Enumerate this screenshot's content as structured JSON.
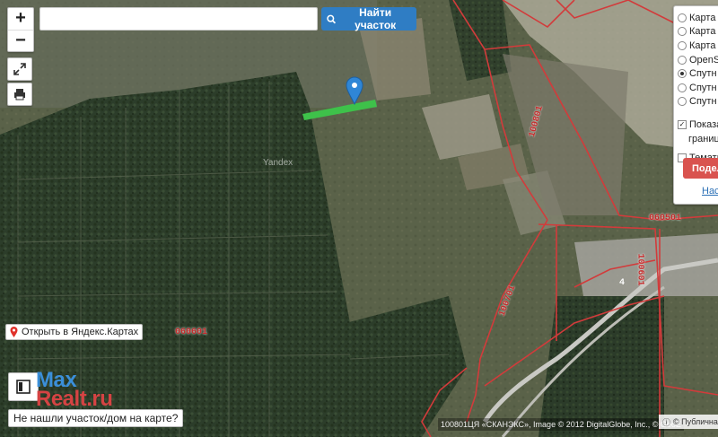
{
  "toolbar": {
    "zoom_in": "+",
    "zoom_out": "−",
    "search_placeholder": "",
    "search_button_label": "Найти участок"
  },
  "layers": {
    "options": [
      {
        "label": "Карта",
        "selected": false
      },
      {
        "label": "Карта",
        "selected": false
      },
      {
        "label": "Карта",
        "selected": false
      },
      {
        "label": "OpenS",
        "selected": false
      },
      {
        "label": "Спутн",
        "selected": true
      },
      {
        "label": "Спутн",
        "selected": false
      },
      {
        "label": "Спутн",
        "selected": false
      }
    ],
    "show_borders_label_1": "Показат",
    "show_borders_label_2": "границ",
    "show_borders_checked": true,
    "thematic_label": "Темати",
    "thematic_checked": false,
    "share_label": "Подель",
    "settings_label": "Наст"
  },
  "links": {
    "open_yandex": "Открыть в Яндекс.Картах",
    "not_found": "Не нашли участок/дом на карте?"
  },
  "logo": {
    "line1": "Max",
    "line2": "Realt.ru"
  },
  "map": {
    "watermark": "Yandex",
    "cadastral_labels": [
      "060601",
      "060501",
      "100801",
      "100701",
      "060601",
      "100601",
      "100801",
      "4"
    ],
    "attribution": "100801ЦЯ «СКАНЭКС», Image © 2012 DigitalGlobe, Inc., © GeoE",
    "copyright": "© Публична",
    "colors": {
      "boundary": "#d23b3b",
      "parcel": "#3ec14a",
      "marker": "#2f86d6"
    }
  }
}
